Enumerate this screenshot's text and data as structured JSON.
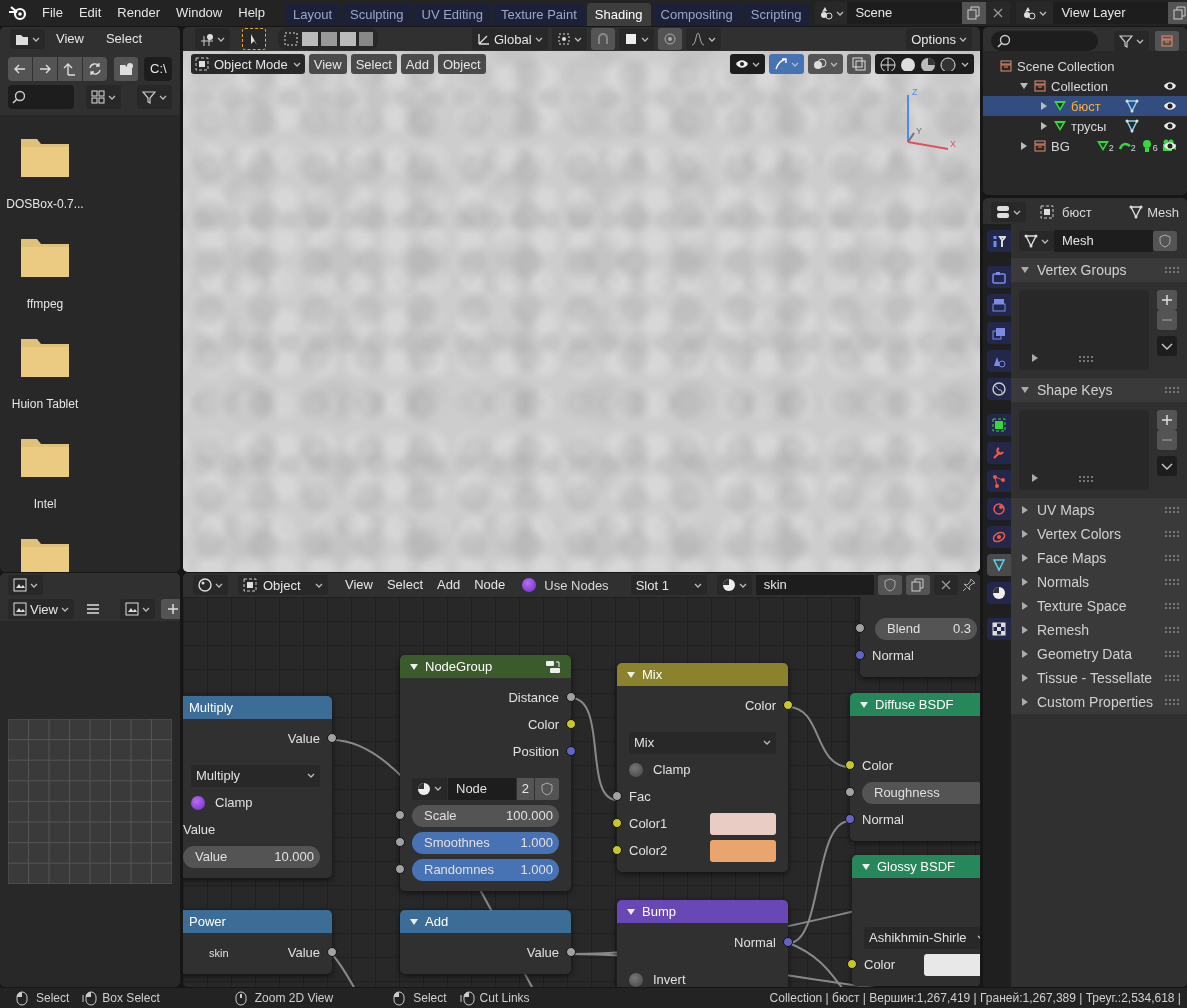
{
  "topbar": {
    "menu": [
      "File",
      "Edit",
      "Render",
      "Window",
      "Help"
    ],
    "workspaces": [
      {
        "label": "Layout",
        "selected": false
      },
      {
        "label": "Sculpting",
        "selected": false
      },
      {
        "label": "UV Editing",
        "selected": false
      },
      {
        "label": "Texture Paint",
        "selected": false
      },
      {
        "label": "Shading",
        "selected": true
      },
      {
        "label": "Compositing",
        "selected": false
      },
      {
        "label": "Scripting",
        "selected": false
      }
    ],
    "scene": "Scene",
    "view_layer": "View Layer"
  },
  "file_browser": {
    "menu": [
      "View",
      "Select"
    ],
    "path": "C:\\",
    "folders": [
      "DOSBox-0.7...",
      "ffmpeg",
      "Huion Tablet",
      "Intel"
    ]
  },
  "viewport": {
    "orientation": "Global",
    "options": "Options",
    "mode": "Object Mode",
    "menu": [
      "View",
      "Select",
      "Add",
      "Object"
    ],
    "axes": [
      "Z",
      "Y",
      "X"
    ]
  },
  "outliner": {
    "tree": [
      {
        "label": "Scene Collection",
        "kind": "scene",
        "selected": false,
        "children": [
          {
            "label": "Collection",
            "kind": "collection",
            "expanded": true,
            "selected": false,
            "visible": true,
            "children": [
              {
                "label": "бюст",
                "kind": "mesh",
                "expanded": false,
                "selected": true,
                "visible": true
              },
              {
                "label": "трусы",
                "kind": "mesh",
                "expanded": false,
                "selected": false,
                "visible": true
              }
            ]
          },
          {
            "label": "BG",
            "kind": "collection",
            "expanded": false,
            "selected": false,
            "visible": true,
            "counts": [
              "2",
              "2",
              "6"
            ]
          }
        ]
      }
    ]
  },
  "properties": {
    "object": "бюст",
    "data": "Mesh",
    "mesh_name": "Mesh",
    "tabs": [
      {
        "kind": "tool",
        "selected": false
      },
      {
        "kind": "render",
        "selected": false
      },
      {
        "kind": "output",
        "selected": false
      },
      {
        "kind": "view-layer",
        "selected": false
      },
      {
        "kind": "scene",
        "selected": false
      },
      {
        "kind": "world",
        "selected": false
      },
      {
        "kind": "object",
        "selected": false
      },
      {
        "kind": "modifiers",
        "selected": false
      },
      {
        "kind": "particles",
        "selected": false
      },
      {
        "kind": "physics",
        "selected": false
      },
      {
        "kind": "constraints",
        "selected": false
      },
      {
        "kind": "data",
        "selected": true
      },
      {
        "kind": "material",
        "selected": false
      },
      {
        "kind": "texture",
        "selected": false
      }
    ],
    "panels": [
      {
        "label": "Vertex Groups",
        "expanded": true
      },
      {
        "label": "Shape Keys",
        "expanded": true
      },
      {
        "label": "UV Maps",
        "expanded": false
      },
      {
        "label": "Vertex Colors",
        "expanded": false
      },
      {
        "label": "Face Maps",
        "expanded": false
      },
      {
        "label": "Normals",
        "expanded": false
      },
      {
        "label": "Texture Space",
        "expanded": false
      },
      {
        "label": "Remesh",
        "expanded": false
      },
      {
        "label": "Geometry Data",
        "expanded": false
      },
      {
        "label": "Tissue - Tessellate",
        "expanded": false
      },
      {
        "label": "Custom Properties",
        "expanded": false
      }
    ]
  },
  "image_editor": {
    "menu": "View"
  },
  "node_editor": {
    "object_type": "Object",
    "menu": [
      "View",
      "Select",
      "Add",
      "Node"
    ],
    "use_nodes": {
      "label": "Use Nodes",
      "checked": true
    },
    "slot": "Slot 1",
    "material": "skin",
    "nodes": [
      {
        "rows": [
          {
            "kind": "field",
            "socket": {
              "color": "#a1a1a1"
            },
            "label": "Blend",
            "value": "0.3"
          },
          {
            "kind": "input",
            "socket": {
              "color": "#6363c7"
            },
            "label": "Normal"
          }
        ]
      },
      {
        "kind": "math",
        "title": "Multiply",
        "rows": [
          {
            "kind": "output",
            "socket": {
              "color": "#a1a1a1"
            },
            "label": "Value"
          },
          {
            "kind": "dropdown",
            "label": "Multiply"
          },
          {
            "kind": "checkbox",
            "label": "Clamp",
            "checked": true
          },
          {
            "kind": "label",
            "label": "Value"
          },
          {
            "kind": "field",
            "label": "Value",
            "value": "10.000"
          }
        ]
      },
      {
        "kind": "group",
        "title": "NodeGroup",
        "expanded": true,
        "rows": [
          {
            "kind": "output",
            "socket": {
              "color": "#a1a1a1"
            },
            "label": "Distance"
          },
          {
            "kind": "output",
            "socket": {
              "color": "#c7c729"
            },
            "label": "Color"
          },
          {
            "kind": "output",
            "socket": {
              "color": "#6363c7"
            },
            "label": "Position"
          },
          {
            "kind": "datablock",
            "label": "Node",
            "users": "2"
          },
          {
            "kind": "field",
            "socket": {
              "color": "#a1a1a1"
            },
            "label": "Scale",
            "value": "100.000",
            "highlighted": false
          },
          {
            "kind": "field",
            "socket": {
              "color": "#a1a1a1"
            },
            "label": "Smoothnes",
            "value": "1.000",
            "highlighted": true
          },
          {
            "kind": "field",
            "socket": {
              "color": "#a1a1a1"
            },
            "label": "Randomnes",
            "value": "1.000",
            "highlighted": true
          }
        ]
      },
      {
        "kind": "color",
        "title": "Mix",
        "expanded": true,
        "rows": [
          {
            "kind": "output",
            "socket": {
              "color": "#c7c729"
            },
            "label": "Color"
          },
          {
            "kind": "dropdown",
            "label": "Mix"
          },
          {
            "kind": "checkbox",
            "label": "Clamp",
            "checked": false
          },
          {
            "kind": "input",
            "socket": {
              "color": "#a1a1a1"
            },
            "label": "Fac"
          },
          {
            "kind": "color",
            "socket": {
              "color": "#c7c729"
            },
            "label": "Color1",
            "color": "#e9cdc4"
          },
          {
            "kind": "color",
            "socket": {
              "color": "#c7c729"
            },
            "label": "Color2",
            "color": "#e9a56d"
          }
        ]
      },
      {
        "kind": "shader",
        "title": "Diffuse BSDF",
        "expanded": true,
        "rows": [
          {
            "kind": "input",
            "socket": {
              "color": "#c7c729"
            },
            "label": "Color"
          },
          {
            "kind": "field",
            "socket": {
              "color": "#a1a1a1"
            },
            "label": "Roughness"
          },
          {
            "kind": "input",
            "socket": {
              "color": "#6363c7"
            },
            "label": "Normal"
          }
        ]
      },
      {
        "kind": "shader",
        "title": "Glossy BSDF",
        "expanded": true,
        "rows": [
          {
            "kind": "dropdown",
            "label": "Ashikhmin-Shirle"
          },
          {
            "kind": "color",
            "socket": {
              "color": "#c7c729"
            },
            "label": "Color",
            "color": "#e8e8e8"
          }
        ]
      },
      {
        "kind": "math",
        "title": "Power",
        "rows": [
          {
            "kind": "output",
            "socket": {
              "color": "#a1a1a1"
            },
            "label": "Value",
            "note": "skin"
          }
        ]
      },
      {
        "kind": "math",
        "title": "Add",
        "expanded": true,
        "rows": [
          {
            "kind": "output",
            "socket": {
              "color": "#a1a1a1"
            },
            "label": "Value"
          }
        ]
      },
      {
        "kind": "vector",
        "title": "Bump",
        "expanded": true,
        "rows": [
          {
            "kind": "output",
            "socket": {
              "color": "#6363c7"
            },
            "label": "Normal"
          },
          {
            "kind": "checkbox",
            "label": "Invert",
            "checked": false
          }
        ]
      }
    ]
  },
  "status_bar": {
    "hint_groups": [
      [
        {
          "kind": "left-mouse",
          "label": "Select"
        },
        {
          "kind": "drag-mouse",
          "label": "Box Select"
        }
      ],
      [
        {
          "kind": "middle-mouse",
          "label": "Zoom 2D View"
        }
      ],
      [
        {
          "kind": "left-mouse",
          "label": "Select"
        },
        {
          "kind": "drag-mouse",
          "label": "Cut Links"
        }
      ]
    ],
    "stats": "Collection | бюст | Вершин:1,267,419 | Граней:1,267,389 | Треуг.:2,534,618 |"
  }
}
